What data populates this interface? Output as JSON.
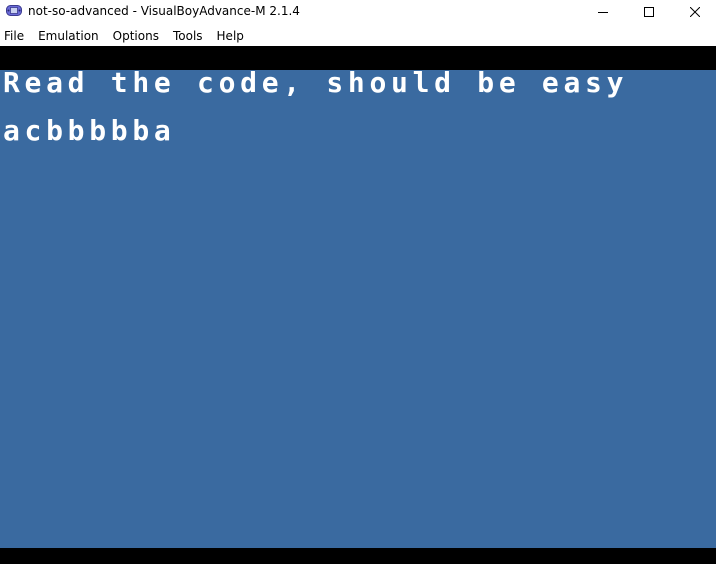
{
  "window": {
    "title": "not-so-advanced - VisualBoyAdvance-M 2.1.4",
    "icon": "gameboy-advance-icon"
  },
  "window_controls": {
    "minimize": "minimize-icon",
    "maximize": "maximize-icon",
    "close": "close-icon"
  },
  "menu": {
    "items": [
      {
        "label": "File"
      },
      {
        "label": "Emulation"
      },
      {
        "label": "Options"
      },
      {
        "label": "Tools"
      },
      {
        "label": "Help"
      }
    ]
  },
  "game_screen": {
    "background_color": "#3a6aa0",
    "text_color": "#ffffff",
    "lines": [
      "Read the code, should be easy",
      "acbbbbba"
    ]
  }
}
